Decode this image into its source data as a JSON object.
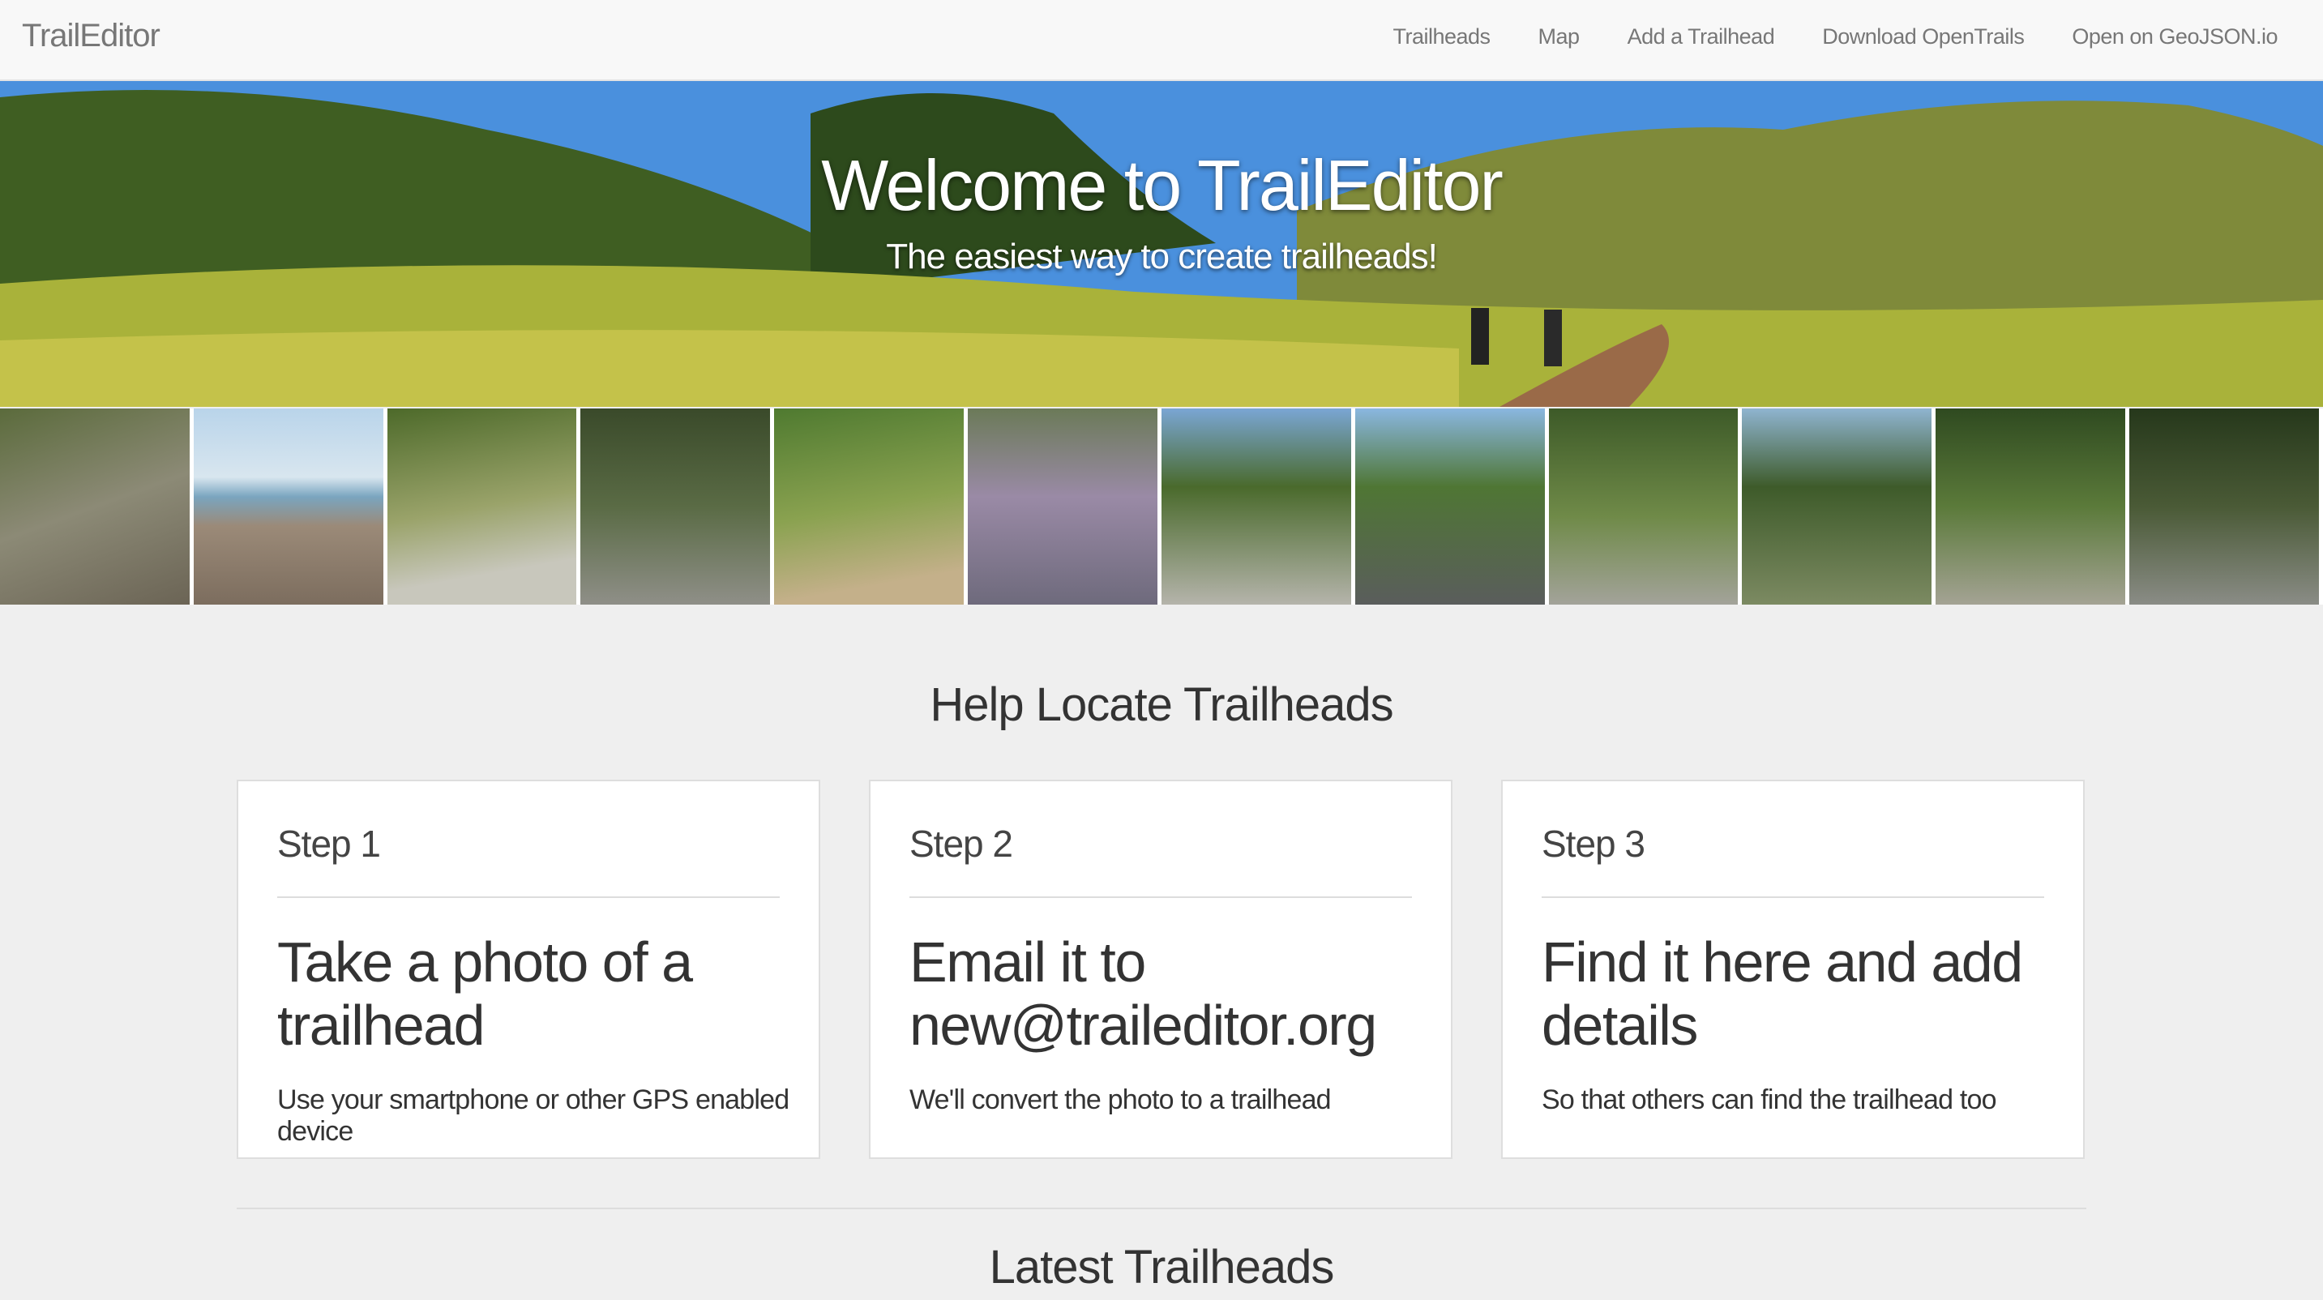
{
  "navbar": {
    "brand": "TrailEditor",
    "links": [
      "Trailheads",
      "Map",
      "Add a Trailhead",
      "Download OpenTrails",
      "Open on GeoJSON.io"
    ]
  },
  "hero": {
    "title": "Welcome to TrailEditor",
    "subtitle": "The easiest way to create trailheads!"
  },
  "strip": {
    "thumb_count": 12
  },
  "help": {
    "title": "Help Locate Trailheads",
    "steps": [
      {
        "label": "Step 1",
        "heading": "Take a photo of a trailhead",
        "text": "Use your smartphone or other GPS enabled device"
      },
      {
        "label": "Step 2",
        "heading": "Email it to new@traileditor.org",
        "text": "We'll convert the photo to a trailhead"
      },
      {
        "label": "Step 3",
        "heading": "Find it here and add details",
        "text": "So that others can find the trailhead too"
      }
    ]
  },
  "latest": {
    "title": "Latest Trailheads"
  }
}
